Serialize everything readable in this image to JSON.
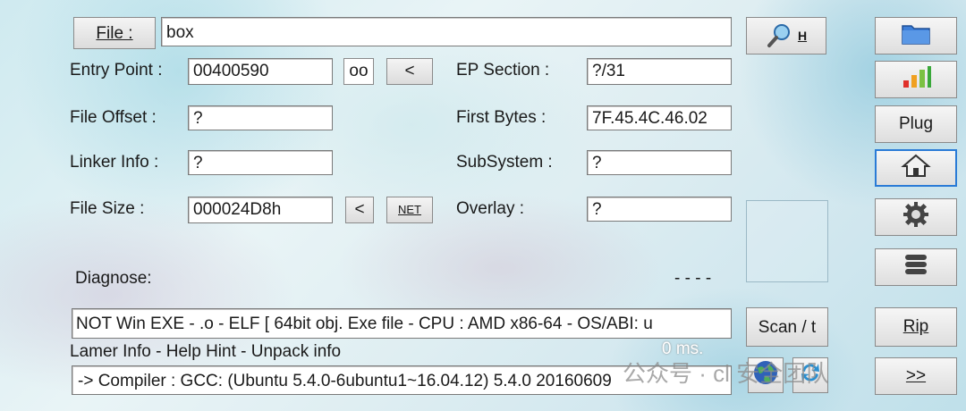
{
  "file": {
    "button_label": "File :",
    "value": "box",
    "h_button_label": "H"
  },
  "entry_point": {
    "label": "Entry Point :",
    "value": "00400590",
    "oo_label": "oo",
    "arrow_label": "<"
  },
  "ep_section": {
    "label": "EP Section :",
    "value": "?/31"
  },
  "file_offset": {
    "label": "File Offset :",
    "value": "?"
  },
  "first_bytes": {
    "label": "First Bytes :",
    "value": "7F.45.4C.46.02"
  },
  "linker_info": {
    "label": "Linker Info :",
    "value": "?"
  },
  "subsystem": {
    "label": "SubSystem :",
    "value": "?"
  },
  "file_size": {
    "label": "File Size :",
    "value": "000024D8h",
    "arrow_label": "<",
    "net_label": "NET"
  },
  "overlay": {
    "label": "Overlay :",
    "value": "?"
  },
  "diagnose": {
    "label": "Diagnose:",
    "dashes": "- - - -"
  },
  "detect": {
    "value": "NOT Win EXE - .o - ELF  [ 64bit obj. Exe file - CPU : AMD x86-64 - OS/ABI: u"
  },
  "info_links": {
    "lamer": "Lamer Info",
    "sep1": " - ",
    "help": "Help Hint",
    "sep2": " - ",
    "unpack": "Unpack info",
    "time": "0 ms."
  },
  "compiler": {
    "value": " -> Compiler : GCC: (Ubuntu 5.4.0-6ubuntu1~16.04.12) 5.4.0 20160609"
  },
  "side": {
    "plug_label": "Plug",
    "rip_label": "Rip",
    "next_label": ">>"
  },
  "scan": {
    "label": "Scan / t"
  },
  "watermark": {
    "text": "公众号 · cl  安全团队"
  },
  "colors": {
    "accent_blue": "#2a7bd6",
    "folder": "#3d7fd9"
  }
}
